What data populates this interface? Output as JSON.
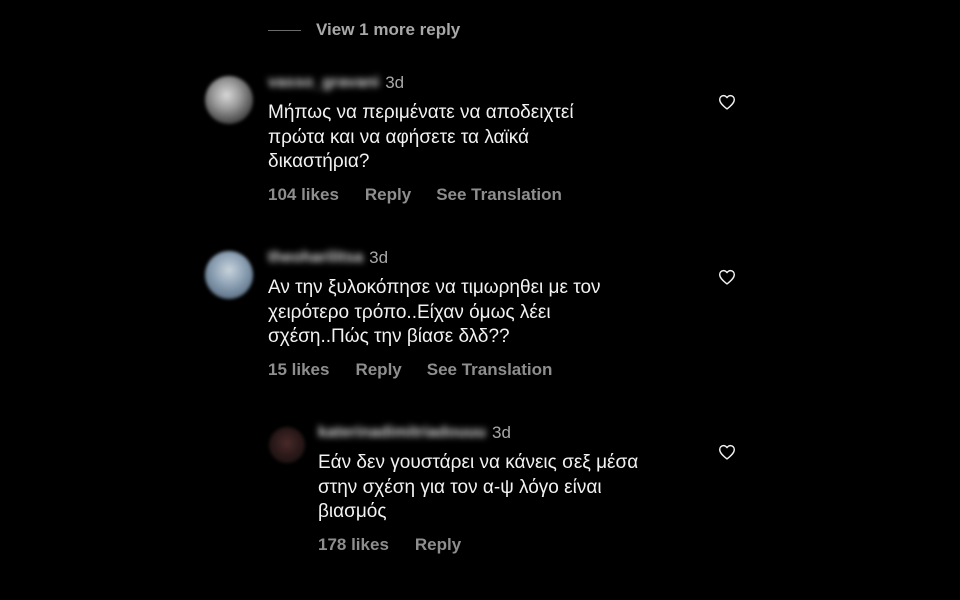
{
  "thread": {
    "view_more_label": "View 1 more reply"
  },
  "comments": [
    {
      "username": "vasso_gravani",
      "time": "3d",
      "lines": [
        "Μήπως να περιμένατε να αποδειχτεί",
        "πρώτα και να αφήσετε τα λαϊκά",
        "δικαστήρια?"
      ],
      "likes": "104 likes",
      "reply_label": "Reply",
      "translate_label": "See Translation"
    },
    {
      "username": "theoharilitsa",
      "time": "3d",
      "lines": [
        "Αν την ξυλοκόπησε να τιμωρηθει με τον",
        "χειρότερο τρόπο..Είχαν όμως λέει",
        "σχέση..Πώς την βίασε δλδ??"
      ],
      "likes": "15 likes",
      "reply_label": "Reply",
      "translate_label": "See Translation"
    },
    {
      "username": "katerinadimitriadouuu",
      "time": "3d",
      "lines": [
        "Εάν δεν γουστάρει να κάνεις σεξ μέσα",
        "στην σχέση για τον α-ψ λόγο είναι",
        "βιασμός"
      ],
      "likes": "178 likes",
      "reply_label": "Reply"
    }
  ],
  "colors": {
    "background": "#000000",
    "primary_text": "#f2f2f2",
    "secondary_text": "#8e8e8e"
  },
  "icons": {
    "avatar": "profile-picture",
    "like": "heart-outline-icon"
  }
}
